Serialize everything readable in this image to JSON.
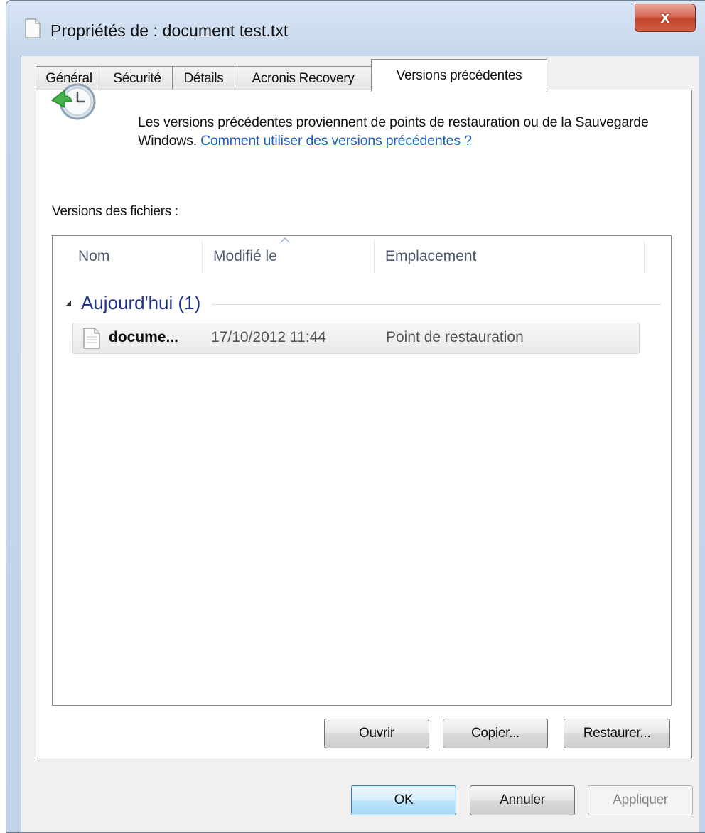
{
  "window": {
    "title": "Propriétés de : document test.txt",
    "close_label": "x"
  },
  "tabs": [
    {
      "label": "Général",
      "active": false
    },
    {
      "label": "Sécurité",
      "active": false
    },
    {
      "label": "Détails",
      "active": false
    },
    {
      "label": "Acronis Recovery",
      "active": false
    },
    {
      "label": "Versions précédentes",
      "active": true
    }
  ],
  "info": {
    "text": "Les versions précédentes proviennent de points de restauration ou de la Sauvegarde Windows.",
    "link": "Comment utiliser des versions précédentes ?"
  },
  "versions": {
    "label": "Versions des fichiers :",
    "columns": [
      "Nom",
      "Modifié le",
      "Emplacement"
    ],
    "group": "Aujourd'hui (1)",
    "rows": [
      {
        "name": "docume...",
        "modified": "17/10/2012 11:44",
        "location": "Point de restauration"
      }
    ]
  },
  "panel_buttons": {
    "open": "Ouvrir",
    "copy": "Copier...",
    "restore": "Restaurer..."
  },
  "dialog_buttons": {
    "ok": "OK",
    "cancel": "Annuler",
    "apply": "Appliquer"
  },
  "colors": {
    "link": "#1f60b6",
    "group_title": "#1e3287",
    "close_button": "#c4442b"
  }
}
